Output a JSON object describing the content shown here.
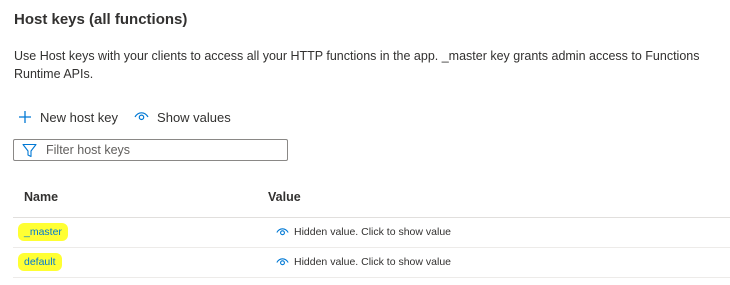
{
  "header": {
    "title": "Host keys (all functions)",
    "description": "Use Host keys with your clients to access all your HTTP functions in the app. _master key grants admin access to Functions Runtime APIs."
  },
  "toolbar": {
    "new_key_label": "New host key",
    "new_key_icon": "plus-icon",
    "show_values_label": "Show values",
    "show_values_icon": "eye-icon"
  },
  "filter": {
    "placeholder": "Filter host keys",
    "value": "",
    "icon": "funnel-icon"
  },
  "table": {
    "columns": [
      "Name",
      "Value"
    ],
    "rows": [
      {
        "name": "_master",
        "value": "Hidden value. Click to show value"
      },
      {
        "name": "default",
        "value": "Hidden value. Click to show value"
      }
    ]
  },
  "colors": {
    "accent": "#0078d4",
    "highlight": "#ffff33",
    "text": "#323130"
  }
}
